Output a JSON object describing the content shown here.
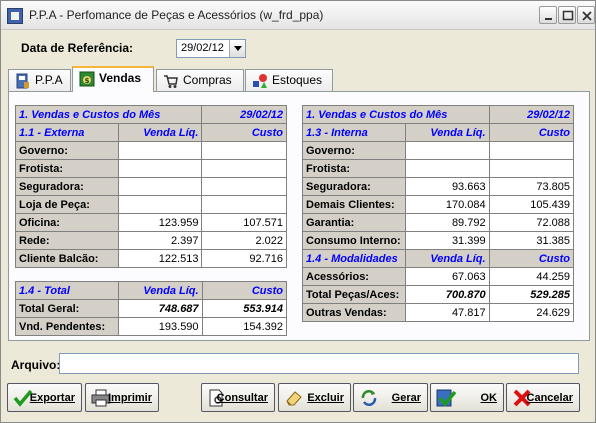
{
  "window": {
    "title": "P.P.A - Perfomance de Peças e Acessórios (w_frd_ppa)"
  },
  "reference": {
    "label": "Data de Referência:",
    "value": "29/02/12"
  },
  "tabs": [
    {
      "label": "P.P.A",
      "icon": "ppa-icon"
    },
    {
      "label": "Vendas",
      "icon": "money-bag-icon"
    },
    {
      "label": "Compras",
      "icon": "cart-icon"
    },
    {
      "label": "Estoques",
      "icon": "shapes-icon"
    }
  ],
  "left_table": {
    "title": "1. Vendas e Custos do Mês",
    "date": "29/02/12",
    "section1": {
      "label": "1.1 - Externa",
      "col1": "Venda Líq.",
      "col2": "Custo"
    },
    "rows": [
      {
        "label": "Governo:",
        "venda": "",
        "custo": ""
      },
      {
        "label": "Frotista:",
        "venda": "",
        "custo": ""
      },
      {
        "label": "Seguradora:",
        "venda": "",
        "custo": ""
      },
      {
        "label": "Loja de Peça:",
        "venda": "",
        "custo": ""
      },
      {
        "label": "Oficina:",
        "venda": "123.959",
        "custo": "107.571"
      },
      {
        "label": "Rede:",
        "venda": "2.397",
        "custo": "2.022"
      },
      {
        "label": "Cliente Balcão:",
        "venda": "122.513",
        "custo": "92.716"
      }
    ],
    "total_section": {
      "label": "1.4 - Total",
      "col1": "Venda Líq.",
      "col2": "Custo"
    },
    "total_rows": [
      {
        "label": "Total Geral:",
        "venda": "748.687",
        "custo": "553.914",
        "emphasis": true
      },
      {
        "label": "Vnd. Pendentes:",
        "venda": "193.590",
        "custo": "154.392",
        "emphasis": false
      }
    ]
  },
  "right_table": {
    "title": "1. Vendas e Custos do Mês",
    "date": "29/02/12",
    "section1": {
      "label": "1.3 - Interna",
      "col1": "Venda Líq.",
      "col2": "Custo"
    },
    "rows": [
      {
        "label": "Governo:",
        "venda": "",
        "custo": ""
      },
      {
        "label": "Frotista:",
        "venda": "",
        "custo": ""
      },
      {
        "label": "Seguradora:",
        "venda": "93.663",
        "custo": "73.805"
      },
      {
        "label": "Demais Clientes:",
        "venda": "170.084",
        "custo": "105.439"
      },
      {
        "label": "Garantia:",
        "venda": "89.792",
        "custo": "72.088"
      },
      {
        "label": "Consumo Interno:",
        "venda": "31.399",
        "custo": "31.385"
      }
    ],
    "section2": {
      "label": "1.4 - Modalidades",
      "col1": "Venda Líq.",
      "col2": "Custo"
    },
    "rows2": [
      {
        "label": "Acessórios:",
        "venda": "67.063",
        "custo": "44.259",
        "emphasis": false
      },
      {
        "label": "Total Peças/Aces:",
        "venda": "700.870",
        "custo": "529.285",
        "emphasis": true
      },
      {
        "label": "Outras Vendas:",
        "venda": "47.817",
        "custo": "24.629",
        "emphasis": false
      }
    ]
  },
  "arquivo": {
    "label": "Arquivo:",
    "value": ""
  },
  "buttons": {
    "exportar": "Exportar",
    "imprimir": "Imprimir",
    "consultar": "Consultar",
    "excluir": "Excluir",
    "gerar": "Gerar",
    "ok": "OK",
    "cancelar": "Cancelar"
  },
  "colors": {
    "header_text": "#0000ff",
    "label_bg": "#d4d0c8",
    "tab_highlight": "#f8b53c"
  }
}
